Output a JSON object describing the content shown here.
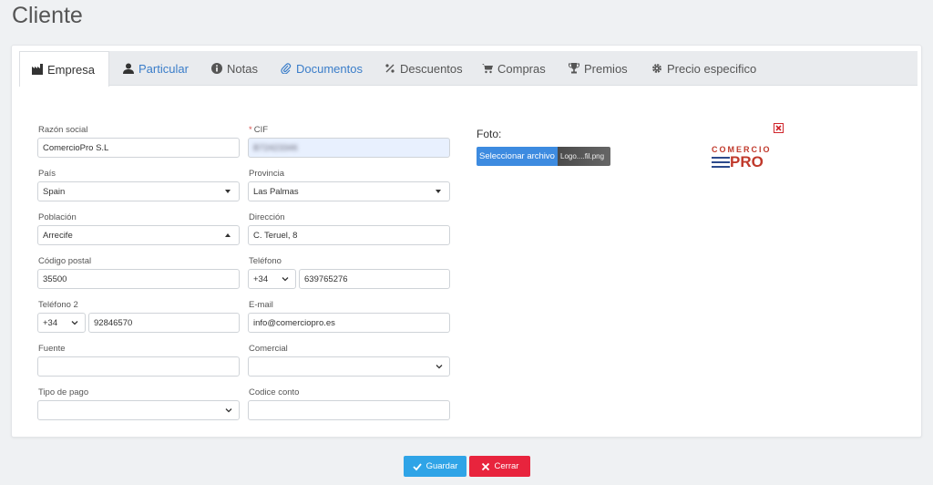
{
  "page_title": "Cliente",
  "tabs": [
    {
      "label": "Empresa",
      "icon": "factory-icon"
    },
    {
      "label": "Particular",
      "icon": "user-icon"
    },
    {
      "label": "Notas",
      "icon": "info-icon"
    },
    {
      "label": "Documentos",
      "icon": "paperclip-icon"
    },
    {
      "label": "Descuentos",
      "icon": "percent-icon"
    },
    {
      "label": "Compras",
      "icon": "cart-icon"
    },
    {
      "label": "Premios",
      "icon": "trophy-icon"
    },
    {
      "label": "Precio especifico",
      "icon": "gear-icon"
    }
  ],
  "form": {
    "razon_social": {
      "label": "Razón social",
      "value": "ComercioPro S.L"
    },
    "cif": {
      "label": "CIF",
      "required_mark": "*",
      "value": "B72423346"
    },
    "pais": {
      "label": "País",
      "value": "Spain"
    },
    "provincia": {
      "label": "Provincia",
      "value": "Las Palmas"
    },
    "poblacion": {
      "label": "Población",
      "value": "Arrecife"
    },
    "direccion": {
      "label": "Dirección",
      "value": "C. Teruel, 8"
    },
    "codigo_postal": {
      "label": "Código postal",
      "value": "35500"
    },
    "telefono": {
      "label": "Teléfono",
      "prefix": "+34",
      "value": "639765276"
    },
    "telefono2": {
      "label": "Teléfono 2",
      "prefix": "+34",
      "value": "92846570"
    },
    "email": {
      "label": "E-mail",
      "value": "info@comerciopro.es"
    },
    "fuente": {
      "label": "Fuente",
      "value": ""
    },
    "comercial": {
      "label": "Comercial",
      "value": ""
    },
    "tipo_pago": {
      "label": "Tipo de pago",
      "value": ""
    },
    "codice_conto": {
      "label": "Codice conto",
      "value": ""
    }
  },
  "foto": {
    "label": "Foto:",
    "select_button": "Seleccionar archivo",
    "file_name": "Logo....fil.png",
    "logo_top": "COMERCIO",
    "logo_main": "PRO"
  },
  "actions": {
    "save": "Guardar",
    "close": "Cerrar"
  },
  "colors": {
    "accent_blue": "#2fa4e7",
    "danger_red": "#e8243d",
    "link_blue": "#3a7dc9"
  }
}
